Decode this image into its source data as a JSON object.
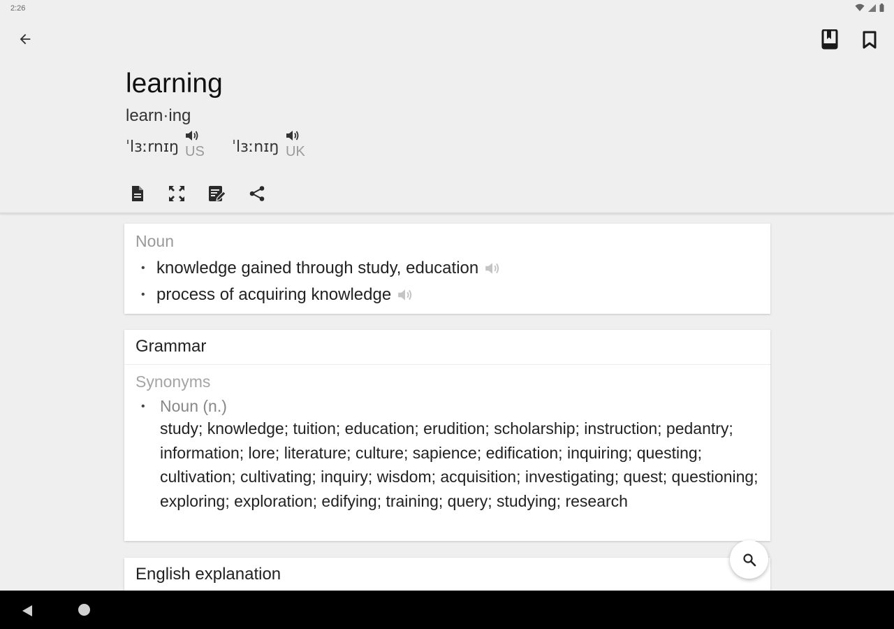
{
  "status": {
    "time": "2:26"
  },
  "entry": {
    "headword": "learning",
    "syllables": "learn·ing",
    "pronunciations": [
      {
        "ipa": "ˈlɜːrnɪŋ",
        "region": "US"
      },
      {
        "ipa": "ˈlɜːnɪŋ",
        "region": "UK"
      }
    ]
  },
  "toolbar_icons": [
    "back-arrow",
    "dictionary-book",
    "bookmark",
    "document",
    "fullscreen",
    "note-edit",
    "share"
  ],
  "noun_card": {
    "pos": "Noun",
    "definitions": [
      "knowledge gained through study, education",
      "process of acquiring knowledge"
    ]
  },
  "grammar_card": {
    "title": "Grammar",
    "synonyms_label": "Synonyms",
    "pos": "Noun (n.)",
    "words": "study; knowledge; tuition; education; erudition; scholarship; instruction; pedantry; information; lore; literature; culture; sapience; edification; inquiring; questing; cultivation; cultivating; inquiry; wisdom; acquisition; investigating; quest; questioning; exploring; exploration; edifying; training; query; studying; research"
  },
  "english_card": {
    "title": "English explanation"
  },
  "colors": {
    "background": "#efefef",
    "card": "#ffffff",
    "muted": "#999999",
    "navbar": "#000000"
  }
}
